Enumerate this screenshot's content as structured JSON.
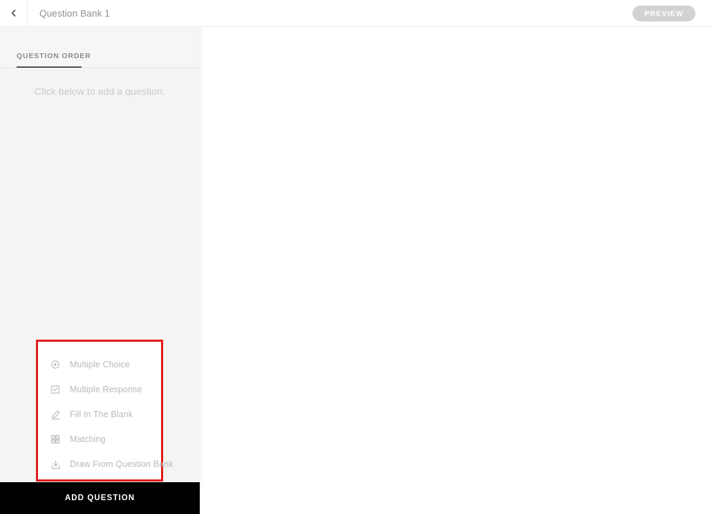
{
  "header": {
    "back_icon": "chevron-left-icon",
    "title": "Question Bank 1",
    "preview_label": "PREVIEW",
    "preview_bg": "#d2d2d4",
    "preview_text_color": "#ffffff"
  },
  "sidebar": {
    "bg": "#f4f4f4",
    "tabs": [
      {
        "label": "QUESTION ORDER",
        "active": true
      }
    ],
    "empty_hint": "Click below to add a question.",
    "add_question_label": "ADD QUESTION",
    "add_question_bg": "#000000"
  },
  "question_type_menu": {
    "highlight_color": "#e01b18",
    "background": "#ffffff",
    "items": [
      {
        "label": "Multiple Choice",
        "icon": "radio-button-icon"
      },
      {
        "label": "Multiple Response",
        "icon": "checkbox-checked-icon"
      },
      {
        "label": "Fill In The Blank",
        "icon": "pencil-edit-icon"
      },
      {
        "label": "Matching",
        "icon": "grid-four-squares-icon"
      },
      {
        "label": "Draw From Question Bank",
        "icon": "download-icon"
      }
    ]
  },
  "main": {
    "content": ""
  }
}
